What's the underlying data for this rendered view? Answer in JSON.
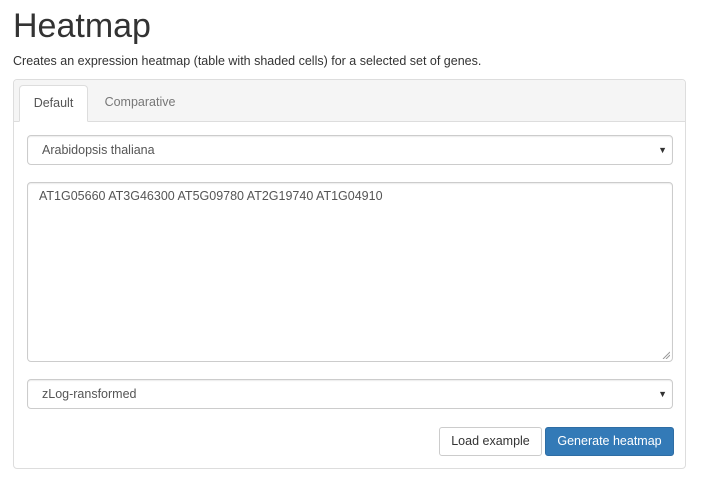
{
  "header": {
    "title": "Heatmap",
    "description": "Creates an expression heatmap (table with shaded cells) for a selected set of genes."
  },
  "tabs": [
    {
      "label": "Default",
      "active": true
    },
    {
      "label": "Comparative",
      "active": false
    }
  ],
  "form": {
    "species_select": {
      "value": "Arabidopsis thaliana",
      "icon": "caret-down-icon"
    },
    "gene_list": {
      "value": "AT1G05660 AT3G46300 AT5G09780 AT2G19740 AT1G04910"
    },
    "transform_select": {
      "value": "zLog-ransformed",
      "icon": "caret-down-icon"
    },
    "load_example_label": "Load example",
    "generate_label": "Generate heatmap"
  },
  "colors": {
    "primary": "#337ab7",
    "border": "#dddddd",
    "panel_header": "#f5f5f5"
  }
}
